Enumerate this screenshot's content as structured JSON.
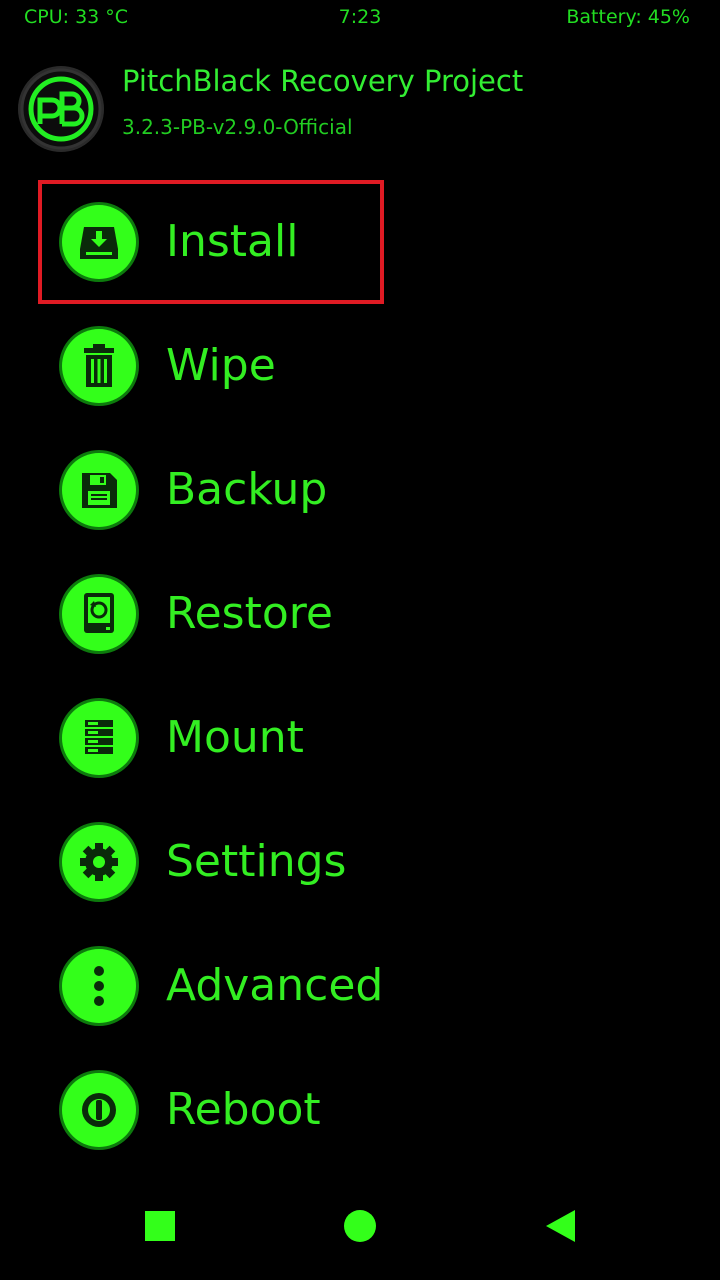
{
  "status_bar": {
    "cpu": "CPU: 33 °C",
    "time": "7:23",
    "battery": "Battery: 45%"
  },
  "header": {
    "title": "PitchBlack Recovery Project",
    "version": "3.2.3-PB-v2.9.0-Official"
  },
  "menu": {
    "items": [
      {
        "label": "Install",
        "icon": "install-icon",
        "selected": true
      },
      {
        "label": "Wipe",
        "icon": "trash-icon"
      },
      {
        "label": "Backup",
        "icon": "floppy-disk-icon"
      },
      {
        "label": "Restore",
        "icon": "restore-icon"
      },
      {
        "label": "Mount",
        "icon": "server-icon"
      },
      {
        "label": "Settings",
        "icon": "gear-icon"
      },
      {
        "label": "Advanced",
        "icon": "more-vertical-icon"
      },
      {
        "label": "Reboot",
        "icon": "power-icon"
      }
    ]
  },
  "navbar": {
    "icons": [
      "recents-square-icon",
      "home-circle-icon",
      "back-triangle-icon"
    ]
  },
  "colors": {
    "accent": "#33ff1a",
    "text": "#33ee22",
    "background": "#000000",
    "selection_border": "#e01b24"
  }
}
